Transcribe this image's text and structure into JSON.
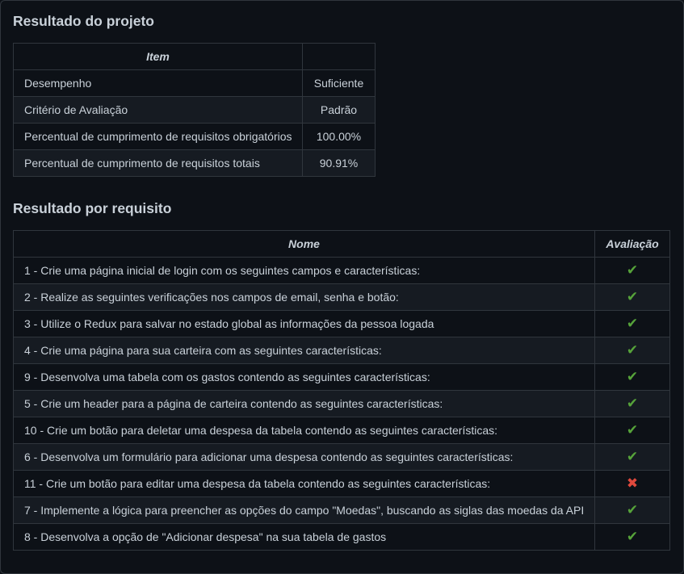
{
  "project_section": {
    "title": "Resultado do projeto",
    "headers": [
      "Item",
      ""
    ],
    "rows": [
      {
        "item": "Desempenho",
        "value": "Suficiente"
      },
      {
        "item": "Critério de Avaliação",
        "value": "Padrão"
      },
      {
        "item": "Percentual de cumprimento de requisitos obrigatórios",
        "value": "100.00%"
      },
      {
        "item": "Percentual de cumprimento de requisitos totais",
        "value": "90.91%"
      }
    ]
  },
  "requirements_section": {
    "title": "Resultado por requisito",
    "headers": [
      "Nome",
      "Avaliação"
    ],
    "rows": [
      {
        "name": "1 - Crie uma página inicial de login com os seguintes campos e características:",
        "status": "pass"
      },
      {
        "name": "2 - Realize as seguintes verificações nos campos de email, senha e botão:",
        "status": "pass"
      },
      {
        "name": "3 - Utilize o Redux para salvar no estado global as informações da pessoa logada",
        "status": "pass"
      },
      {
        "name": "4 - Crie uma página para sua carteira com as seguintes características:",
        "status": "pass"
      },
      {
        "name": "9 - Desenvolva uma tabela com os gastos contendo as seguintes características:",
        "status": "pass"
      },
      {
        "name": "5 - Crie um header para a página de carteira contendo as seguintes características:",
        "status": "pass"
      },
      {
        "name": "10 - Crie um botão para deletar uma despesa da tabela contendo as seguintes características:",
        "status": "pass"
      },
      {
        "name": "6 - Desenvolva um formulário para adicionar uma despesa contendo as seguintes características:",
        "status": "pass"
      },
      {
        "name": "11 - Crie um botão para editar uma despesa da tabela contendo as seguintes características:",
        "status": "fail"
      },
      {
        "name": "7 - Implemente a lógica para preencher as opções do campo \"Moedas\", buscando as siglas das moedas da API",
        "status": "pass"
      },
      {
        "name": "8 - Desenvolva a opção de \"Adicionar despesa\" na sua tabela de gastos",
        "status": "pass"
      }
    ]
  },
  "icons": {
    "pass": {
      "name": "check-mark-icon",
      "glyph": "✔",
      "color": "#56a33a"
    },
    "fail": {
      "name": "cross-mark-icon",
      "glyph": "✖",
      "color": "#e0493d"
    }
  }
}
